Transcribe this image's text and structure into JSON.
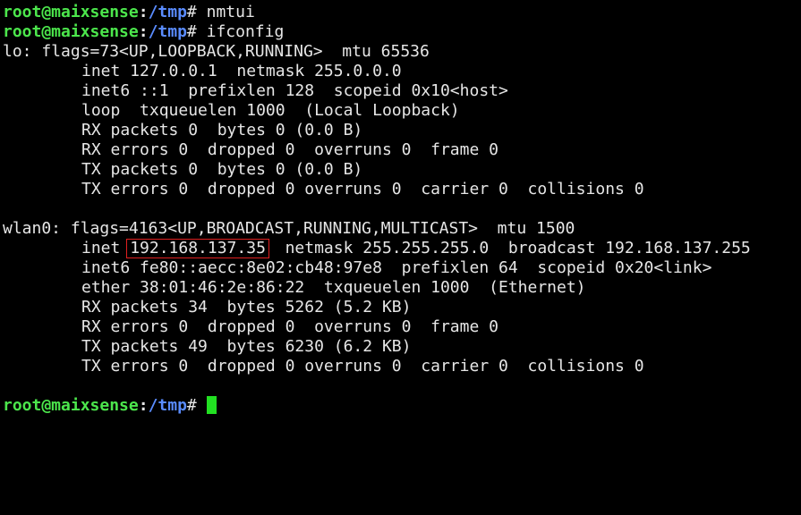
{
  "colors": {
    "background": "#000000",
    "user_host": "#4ce64c",
    "path": "#5a8cff",
    "text": "#e6e6e6",
    "highlight_box": "#e02020",
    "cursor": "#22e022"
  },
  "prompt": {
    "user_host": "root@maixsense",
    "separator": ":",
    "path": "/tmp",
    "symbol": "# "
  },
  "commands": [
    "nmtui",
    "ifconfig"
  ],
  "interfaces": [
    {
      "header": "lo: flags=73<UP,LOOPBACK,RUNNING>  mtu 65536",
      "lines": [
        "inet 127.0.0.1  netmask 255.0.0.0",
        "inet6 ::1  prefixlen 128  scopeid 0x10<host>",
        "loop  txqueuelen 1000  (Local Loopback)",
        "RX packets 0  bytes 0 (0.0 B)",
        "RX errors 0  dropped 0  overruns 0  frame 0",
        "TX packets 0  bytes 0 (0.0 B)",
        "TX errors 0  dropped 0 overruns 0  carrier 0  collisions 0"
      ]
    },
    {
      "header": "wlan0: flags=4163<UP,BROADCAST,RUNNING,MULTICAST>  mtu 1500",
      "inet_line": {
        "prefix": "inet ",
        "address": "192.168.137.35",
        "suffix": "  netmask 255.255.255.0  broadcast 192.168.137.255"
      },
      "lines": [
        "inet6 fe80::aecc:8e02:cb48:97e8  prefixlen 64  scopeid 0x20<link>",
        "ether 38:01:46:2e:86:22  txqueuelen 1000  (Ethernet)",
        "RX packets 34  bytes 5262 (5.2 KB)",
        "RX errors 0  dropped 0  overruns 0  frame 0",
        "TX packets 49  bytes 6230 (6.2 KB)",
        "TX errors 0  dropped 0 overruns 0  carrier 0  collisions 0"
      ]
    }
  ]
}
